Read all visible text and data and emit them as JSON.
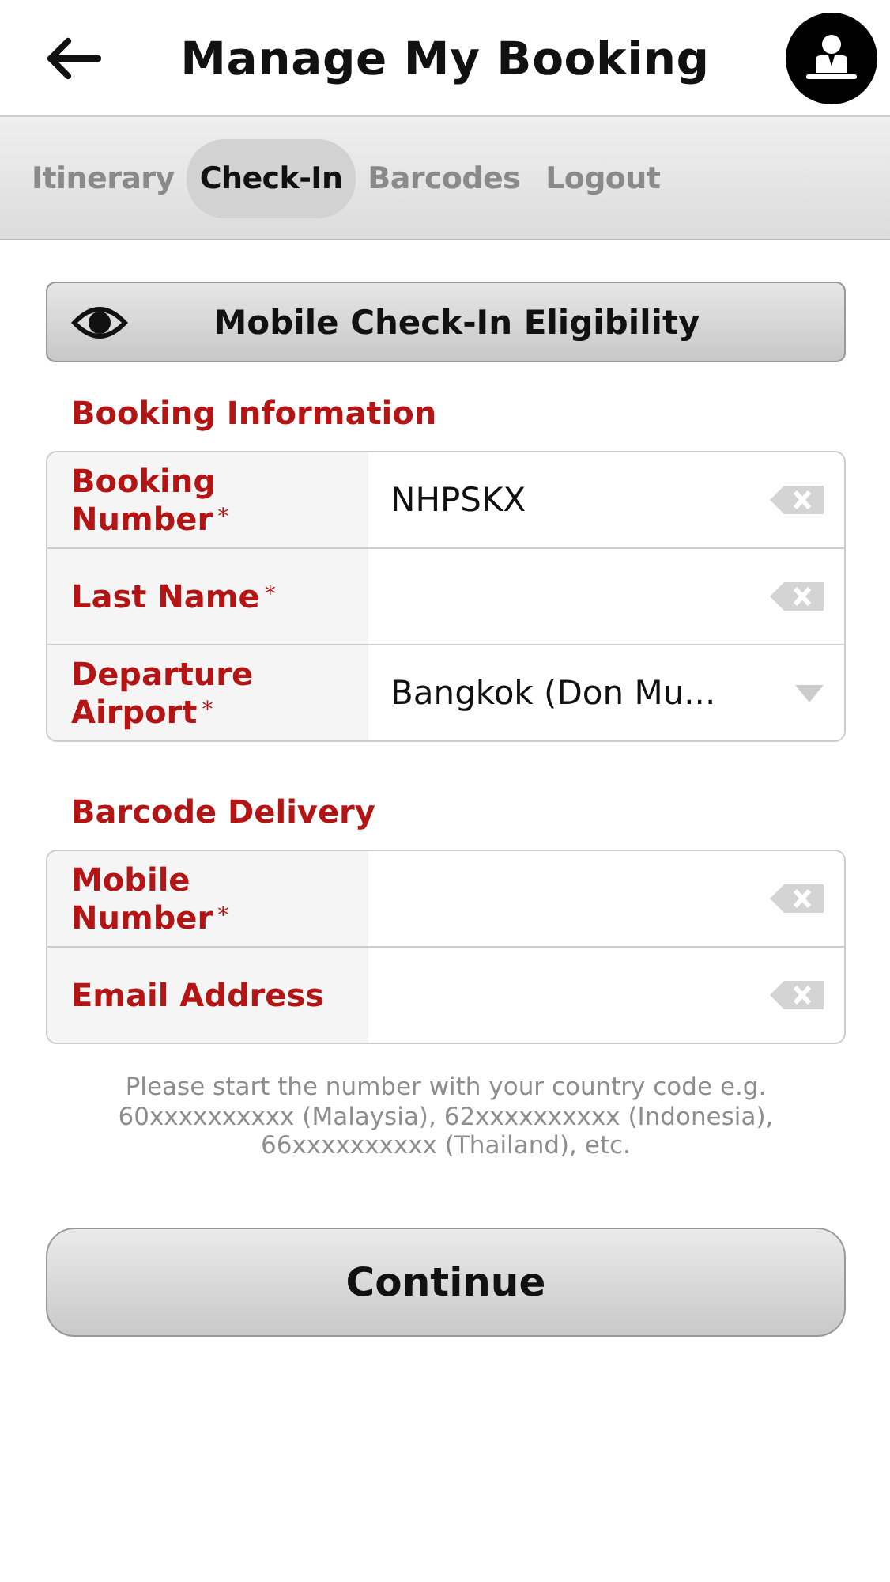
{
  "header": {
    "title": "Manage My Booking"
  },
  "tabs": [
    {
      "label": "Itinerary",
      "selected": false
    },
    {
      "label": "Check-In",
      "selected": true
    },
    {
      "label": "Barcodes",
      "selected": false
    },
    {
      "label": "Logout",
      "selected": false
    }
  ],
  "eligibility_button": {
    "label": "Mobile Check-In Eligibility"
  },
  "sections": [
    {
      "title": "Booking Information",
      "fields": [
        {
          "kind": "text",
          "label": "Booking Number",
          "marker": "*",
          "value": "NHPSKX"
        },
        {
          "kind": "text",
          "label": "Last Name",
          "marker": "*"
        },
        {
          "kind": "select",
          "label": "Departure Airport",
          "marker": "*",
          "value": "Bangkok (Don Mu..."
        }
      ]
    },
    {
      "title": "Barcode Delivery",
      "fields": [
        {
          "kind": "text",
          "label": "Mobile Number",
          "marker": "*"
        },
        {
          "kind": "text",
          "label": "Email Address"
        }
      ]
    }
  ],
  "note": "Please start the number with your country code e.g. 60xxxxxxxxxx (Malaysia), 62xxxxxxxxxx (Indonesia), 66xxxxxxxxxx (Thailand), etc.",
  "continue_button": {
    "label": "Continue"
  }
}
